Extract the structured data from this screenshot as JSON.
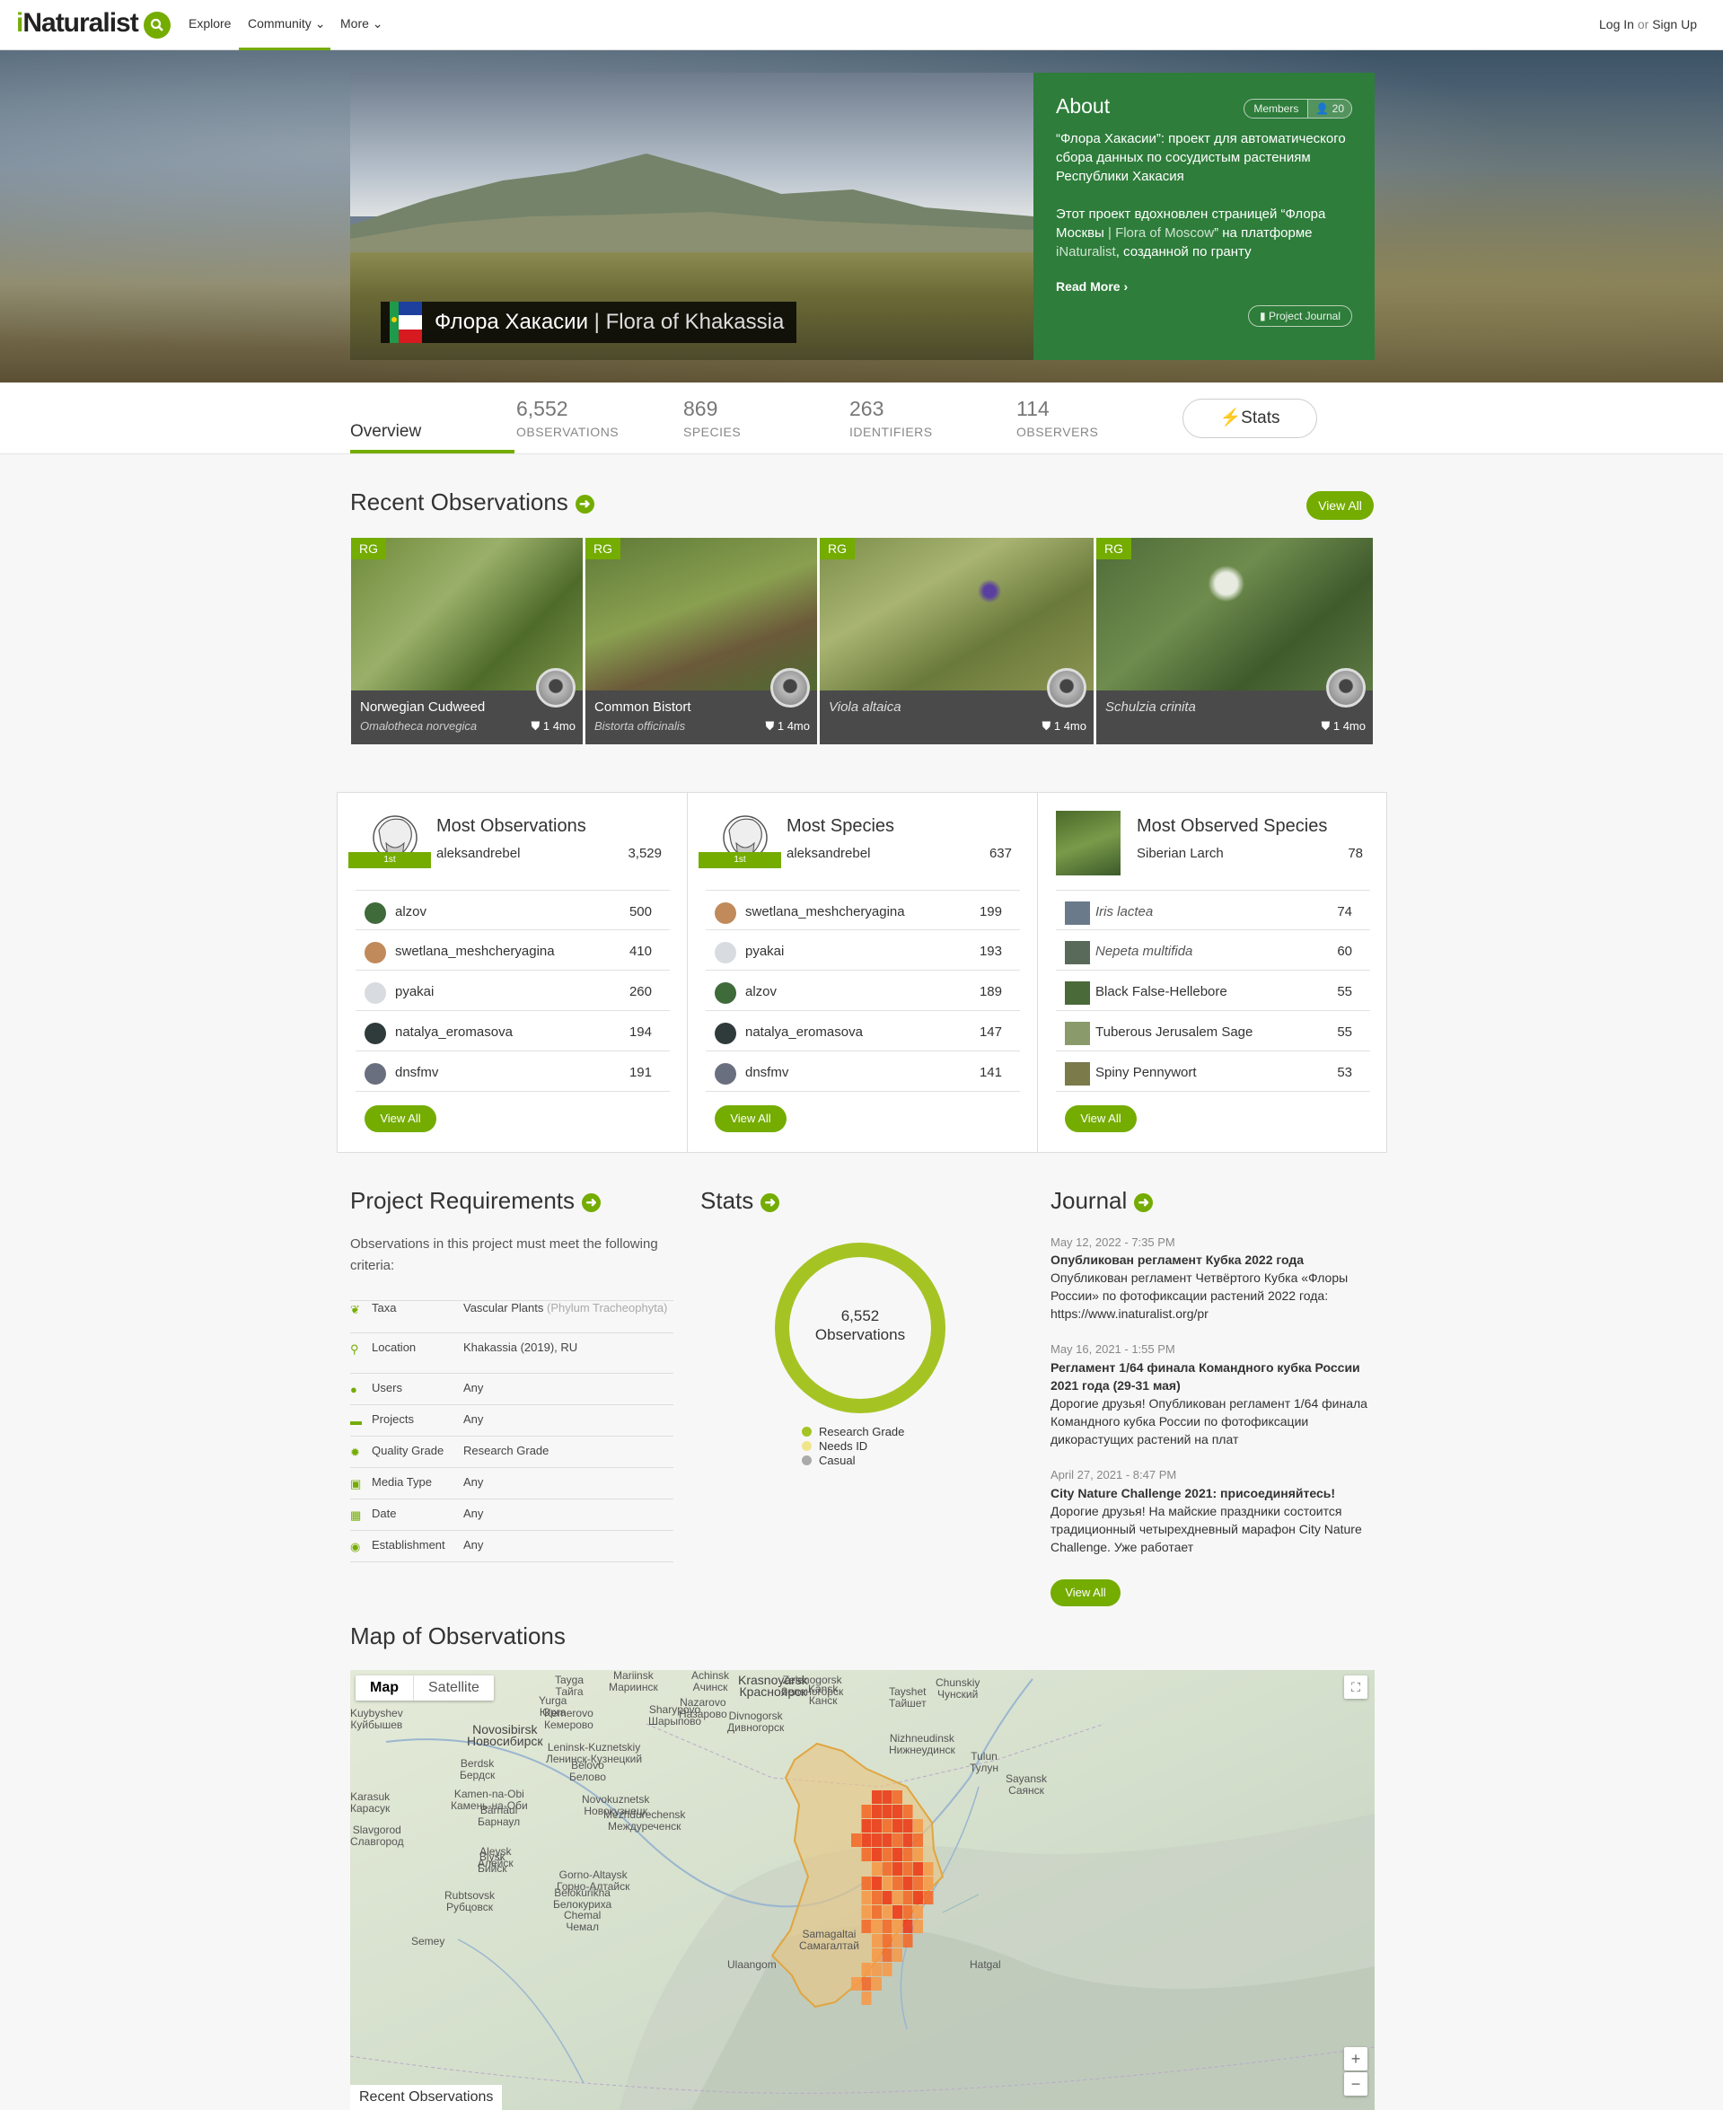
{
  "header": {
    "logo_i": "i",
    "logo_rest": "Naturalist",
    "nav": [
      "Explore",
      "Community",
      "More"
    ],
    "login": "Log In",
    "or": "or",
    "signup": "Sign Up"
  },
  "hero": {
    "title_ru": "Флора Хакасии",
    "title_sep": " | ",
    "title_en": "Flora of Khakassia",
    "about_heading": "About",
    "members_label": "Members",
    "members_count": "20",
    "para1": "“Флора Хакасии”: проект для автоматического сбора данных по сосудистым растениям Республики Хакасия",
    "para2_a": "Этот проект вдохновлен страницей “Флора Москвы ",
    "para2_b": "| Flora of Moscow",
    "para2_c": "” на платформе ",
    "para2_d": "iNaturalist",
    "para2_e": ", созданной по гранту",
    "read_more": "Read More",
    "journal_button": "Project Journal"
  },
  "statsbar": {
    "overview": "Overview",
    "tabs": [
      {
        "num": "6,552",
        "label": "OBSERVATIONS"
      },
      {
        "num": "869",
        "label": "SPECIES"
      },
      {
        "num": "263",
        "label": "IDENTIFIERS"
      },
      {
        "num": "114",
        "label": "OBSERVERS"
      }
    ],
    "stats_button": "Stats"
  },
  "recent": {
    "heading": "Recent Observations",
    "view_all": "View All",
    "items": [
      {
        "badge": "RG",
        "name": "Norwegian Cudweed",
        "sci": "Omalotheca norvegica",
        "ids": "1",
        "age": "4mo"
      },
      {
        "badge": "RG",
        "name": "Common Bistort",
        "sci": "Bistorta officinalis",
        "ids": "1",
        "age": "4mo"
      },
      {
        "badge": "RG",
        "name": "Viola altaica",
        "sci": "",
        "ids": "1",
        "age": "4mo"
      },
      {
        "badge": "RG",
        "name": "Schulzia crinita",
        "sci": "",
        "ids": "1",
        "age": "4mo"
      }
    ]
  },
  "boards": {
    "most_obs": {
      "heading": "Most Observations",
      "ribbon": "1st",
      "top_user": "aleksandrebel",
      "top_value": "3,529",
      "rows": [
        {
          "name": "alzov",
          "value": "500"
        },
        {
          "name": "swetlana_meshcheryagina",
          "value": "410"
        },
        {
          "name": "pyakai",
          "value": "260"
        },
        {
          "name": "natalya_eromasova",
          "value": "194"
        },
        {
          "name": "dnsfmv",
          "value": "191"
        }
      ],
      "view_all": "View All"
    },
    "most_species": {
      "heading": "Most Species",
      "ribbon": "1st",
      "top_user": "aleksandrebel",
      "top_value": "637",
      "rows": [
        {
          "name": "swetlana_meshcheryagina",
          "value": "199"
        },
        {
          "name": "pyakai",
          "value": "193"
        },
        {
          "name": "alzov",
          "value": "189"
        },
        {
          "name": "natalya_eromasova",
          "value": "147"
        },
        {
          "name": "dnsfmv",
          "value": "141"
        }
      ],
      "view_all": "View All"
    },
    "most_observed": {
      "heading": "Most Observed Species",
      "top_user": "Siberian Larch",
      "top_value": "78",
      "rows": [
        {
          "name": "Iris lactea",
          "value": "74"
        },
        {
          "name": "Nepeta multifida",
          "value": "60"
        },
        {
          "name": "Black False-Hellebore",
          "value": "55"
        },
        {
          "name": "Tuberous Jerusalem Sage",
          "value": "55"
        },
        {
          "name": "Spiny Pennywort",
          "value": "53"
        }
      ],
      "view_all": "View All"
    }
  },
  "requirements": {
    "heading": "Project Requirements",
    "intro": "Observations in this project must meet the following criteria:",
    "rows": [
      {
        "key": "Taxa",
        "value": "Vascular Plants",
        "extra": "(Phylum Tracheophyta)"
      },
      {
        "key": "Location",
        "value": "Khakassia (2019), RU",
        "extra": ""
      },
      {
        "key": "Users",
        "value": "Any",
        "extra": ""
      },
      {
        "key": "Projects",
        "value": "Any",
        "extra": ""
      },
      {
        "key": "Quality Grade",
        "value": "Research Grade",
        "extra": ""
      },
      {
        "key": "Media Type",
        "value": "Any",
        "extra": ""
      },
      {
        "key": "Date",
        "value": "Any",
        "extra": ""
      },
      {
        "key": "Establishment",
        "value": "Any",
        "extra": ""
      }
    ]
  },
  "stats": {
    "heading": "Stats",
    "center_num": "6,552",
    "center_label": "Observations",
    "legend": [
      {
        "label": "Research Grade",
        "color": "#a5c424"
      },
      {
        "label": "Needs ID",
        "color": "#f1e58b"
      },
      {
        "label": "Casual",
        "color": "#aaaaaa"
      }
    ],
    "research_fraction": 1.0
  },
  "journal": {
    "heading": "Journal",
    "posts": [
      {
        "date": "May 12, 2022 - 7:35 PM",
        "title": "Опубликован регламент Кубка 2022 года",
        "body": "Опубликован регламент Четвёртого Кубка «Флоры России» по фотофиксации растений 2022 года: https://www.inaturalist.org/pr"
      },
      {
        "date": "May 16, 2021 - 1:55 PM",
        "title": "Регламент 1/64 финала Командного кубка России 2021 года (29-31 мая)",
        "body": "Дорогие друзья! Опубликован регламент 1/64 финала Командного кубка России по фотофиксации дикорастущих растений на плат"
      },
      {
        "date": "April 27, 2021 - 8:47 PM",
        "title": "City Nature Challenge 2021: присоединяйтесь!",
        "body": "Дорогие друзья! На майские праздники состоится традиционный четырехдневный марафон City Nature Challenge. Уже работает"
      }
    ],
    "view_all": "View All"
  },
  "map": {
    "heading": "Map of Observations",
    "type_map": "Map",
    "type_sat": "Satellite",
    "recent_tab": "Recent Observations",
    "labels": [
      {
        "en": "Novosibirsk",
        "ru": "Новосибирск",
        "big": true
      },
      {
        "en": "Krasnoyarsk",
        "ru": "Красноярск",
        "big": true
      },
      {
        "en": "Kemerovo",
        "ru": "Кемерово",
        "big": false
      },
      {
        "en": "Barnaul",
        "ru": "Барнаул",
        "big": false
      },
      {
        "en": "Biysk",
        "ru": "Бийск",
        "big": false
      },
      {
        "en": "Novokuznetsk",
        "ru": "Новокузнецк",
        "big": false
      },
      {
        "en": "Achinsk",
        "ru": "Ачинск",
        "big": false
      },
      {
        "en": "Kansk",
        "ru": "Канск",
        "big": false
      },
      {
        "en": "Kuybyshev",
        "ru": "Куйбышев",
        "big": false
      },
      {
        "en": "Rubtsovsk",
        "ru": "Рубцовск",
        "big": false
      },
      {
        "en": "Gorno-Altaysk",
        "ru": "Горно-Алтайск",
        "big": false
      },
      {
        "en": "Aleysk",
        "ru": "Алейск",
        "big": false
      },
      {
        "en": "Slavgorod",
        "ru": "Славгород",
        "big": false
      },
      {
        "en": "Berdsk",
        "ru": "Бердск",
        "big": false
      },
      {
        "en": "Belovo",
        "ru": "Белово",
        "big": false
      },
      {
        "en": "Tulun",
        "ru": "Тулун",
        "big": false
      },
      {
        "en": "Nizhneudinsk",
        "ru": "Нижнеудинск",
        "big": false
      },
      {
        "en": "Sayansk",
        "ru": "Саянск",
        "big": false
      },
      {
        "en": "Zelenogorsk",
        "ru": "Зеленогорск",
        "big": false
      },
      {
        "en": "Tayga",
        "ru": "Тайга",
        "big": false
      },
      {
        "en": "Yurga",
        "ru": "Юрга",
        "big": false
      },
      {
        "en": "Mariinsk",
        "ru": "Мариинск",
        "big": false
      },
      {
        "en": "Nazarovo",
        "ru": "Назарово",
        "big": false
      },
      {
        "en": "Sharypovo",
        "ru": "Шарыпово",
        "big": false
      },
      {
        "en": "Leninsk-Kuznetskiy",
        "ru": "Ленинск-Кузнецкий",
        "big": false
      },
      {
        "en": "Mezhdurechensk",
        "ru": "Междуреченск",
        "big": false
      },
      {
        "en": "Kamen-na-Obi",
        "ru": "Камень-на-Оби",
        "big": false
      },
      {
        "en": "Belokurikha",
        "ru": "Белокуриха",
        "big": false
      },
      {
        "en": "Chunskiy",
        "ru": "Чунский",
        "big": false
      },
      {
        "en": "Tayshet",
        "ru": "Тайшет",
        "big": false
      },
      {
        "en": "Divnogorsk",
        "ru": "Дивногорск",
        "big": false
      },
      {
        "en": "Karasuk",
        "ru": "Карасук",
        "big": false
      },
      {
        "en": "Semey",
        "ru": "",
        "big": false
      },
      {
        "en": "Ulaangom",
        "ru": "",
        "big": false
      },
      {
        "en": "Samagaltai",
        "ru": "Самагалтай",
        "big": false
      },
      {
        "en": "Hatgal",
        "ru": "",
        "big": false
      },
      {
        "en": "Chemal",
        "ru": "Чемал",
        "big": false
      }
    ]
  }
}
